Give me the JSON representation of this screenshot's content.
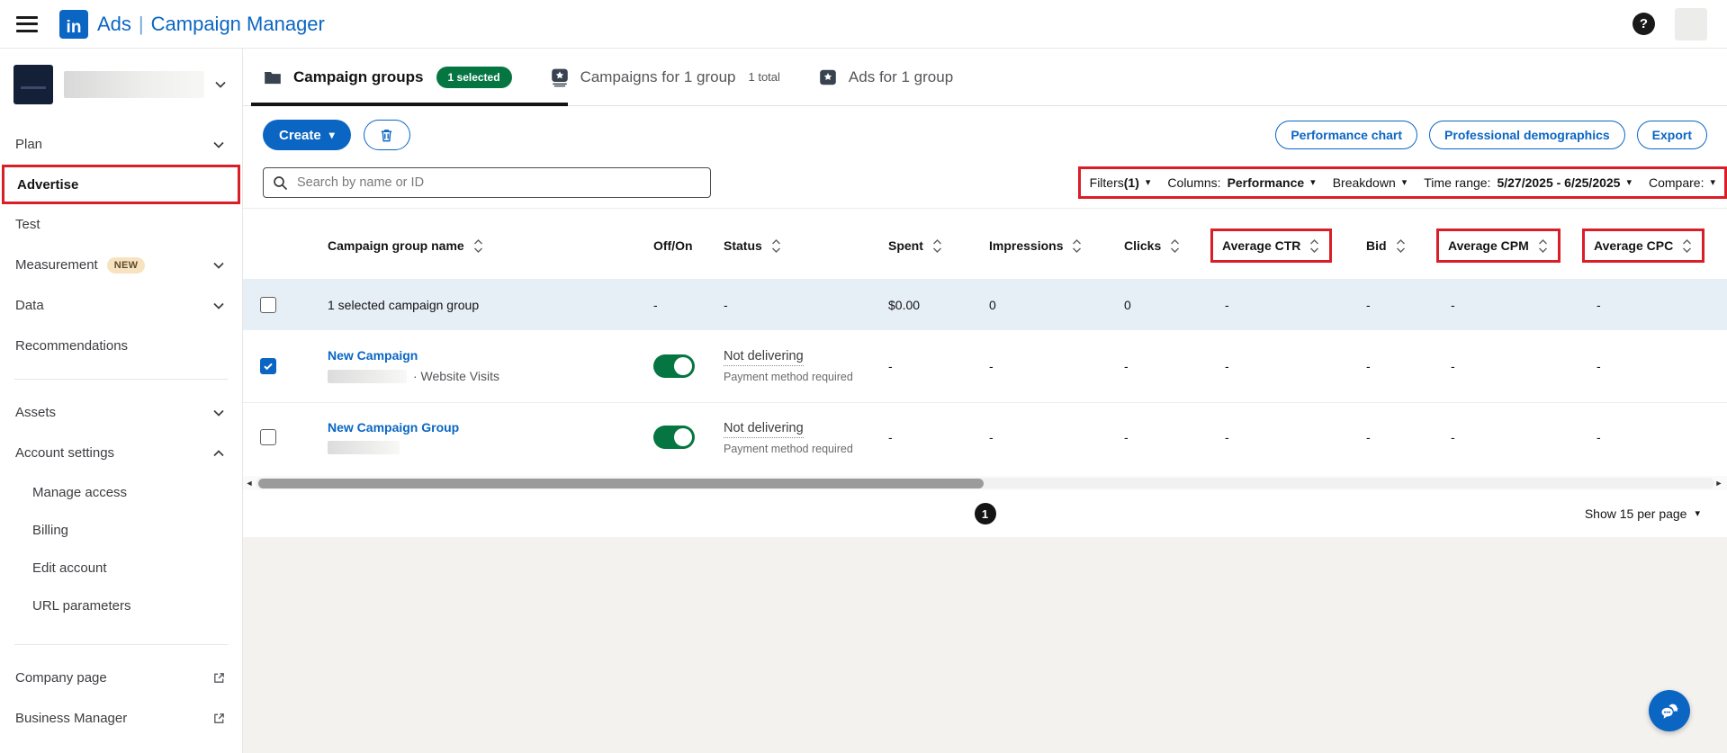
{
  "header": {
    "logo": "in",
    "app": "Ads",
    "divider": "|",
    "product": "Campaign Manager",
    "help": "?"
  },
  "icons": {
    "caret_down": "▾",
    "scroll_left": "◄",
    "scroll_right": "►"
  },
  "sidebar": {
    "items": {
      "plan": "Plan",
      "advertise": "Advertise",
      "test": "Test",
      "measurement": "Measurement",
      "measurement_badge": "NEW",
      "data": "Data",
      "recommendations": "Recommendations",
      "assets": "Assets",
      "account_settings": "Account settings",
      "manage_access": "Manage access",
      "billing": "Billing",
      "edit_account": "Edit account",
      "url_parameters": "URL parameters",
      "company_page": "Company page",
      "business_manager": "Business Manager"
    }
  },
  "tabs": {
    "groups": {
      "label": "Campaign groups",
      "badge": "1 selected"
    },
    "campaigns": {
      "label": "Campaigns for 1 group",
      "count": "1 total"
    },
    "ads": {
      "label": "Ads for 1 group"
    }
  },
  "toolbar": {
    "create_label": "Create",
    "performance_chart": "Performance chart",
    "professional_demographics": "Professional demographics",
    "export": "Export"
  },
  "search": {
    "placeholder": "Search by name or ID"
  },
  "filters": {
    "filters_label": "Filters",
    "filters_count": "(1)",
    "columns_label": "Columns:",
    "columns_value": "Performance",
    "breakdown_label": "Breakdown",
    "time_range_label": "Time range:",
    "time_range_value": "5/27/2025 - 6/25/2025",
    "compare_label": "Compare:"
  },
  "table": {
    "headers": {
      "name": "Campaign group name",
      "offon": "Off/On",
      "status": "Status",
      "spent": "Spent",
      "impressions": "Impressions",
      "clicks": "Clicks",
      "avg_ctr": "Average CTR",
      "bid": "Bid",
      "avg_cpm": "Average CPM",
      "avg_cpc": "Average CPC"
    },
    "summary": {
      "name": "1 selected campaign group",
      "offon": "-",
      "status": "-",
      "spent": "$0.00",
      "impressions": "0",
      "clicks": "0",
      "avg_ctr": "-",
      "bid": "-",
      "avg_cpm": "-",
      "avg_cpc": "-"
    },
    "rows": {
      "0": {
        "name": "New Campaign",
        "meta": "· Website Visits",
        "status": "Not delivering",
        "status_detail": "Payment method required",
        "spent": "-",
        "impressions": "-",
        "clicks": "-",
        "avg_ctr": "-",
        "bid": "-",
        "avg_cpm": "-",
        "avg_cpc": "-"
      },
      "1": {
        "name": "New Campaign Group",
        "meta": "",
        "status": "Not delivering",
        "status_detail": "Payment method required",
        "spent": "-",
        "impressions": "-",
        "clicks": "-",
        "avg_ctr": "-",
        "bid": "-",
        "avg_cpm": "-",
        "avg_cpc": "-"
      }
    }
  },
  "pagination": {
    "page": "1",
    "page_size_label": "Show 15 per page"
  }
}
